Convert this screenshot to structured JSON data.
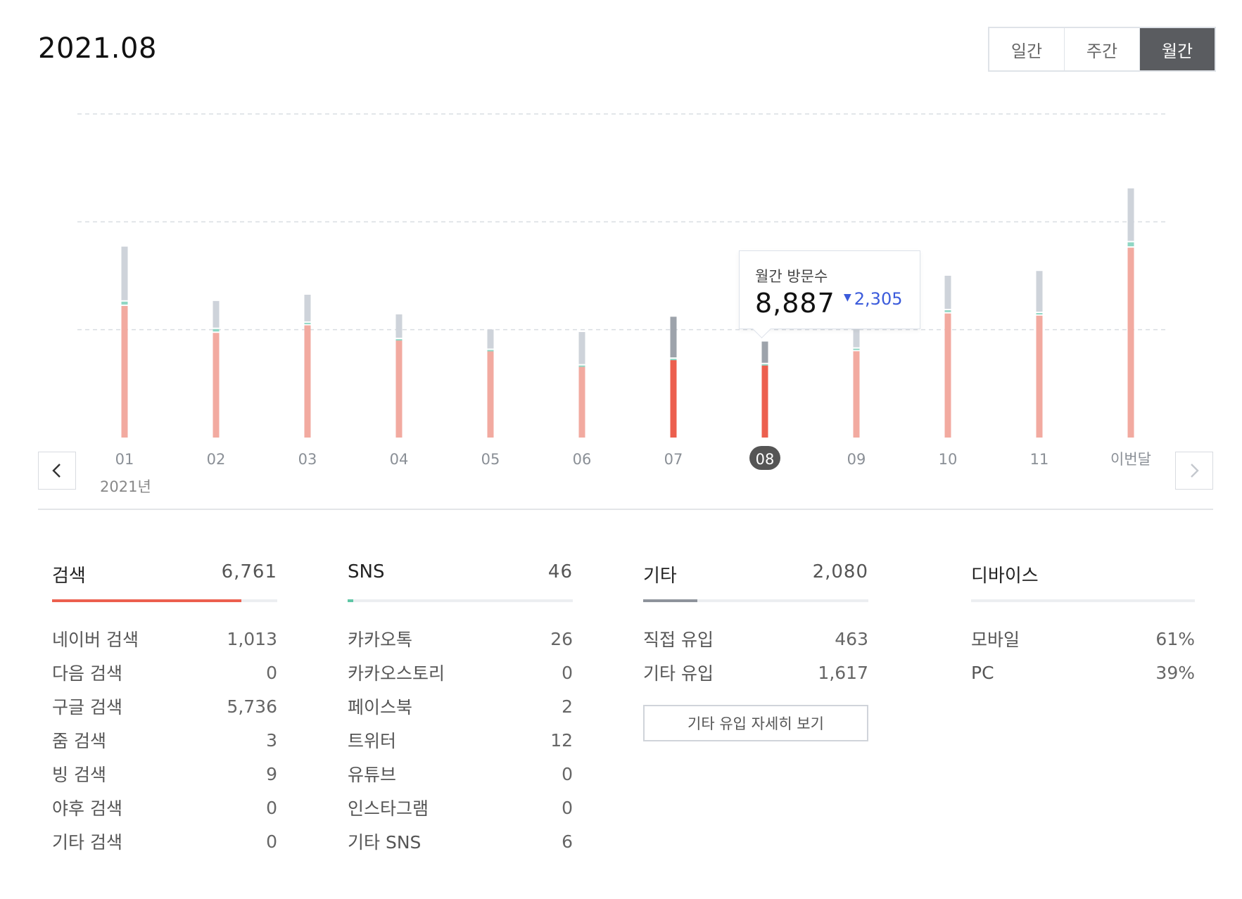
{
  "header": {
    "period": "2021.08"
  },
  "period_toggle": {
    "options": [
      "일간",
      "주간",
      "월간"
    ],
    "active": 2
  },
  "chart_data": {
    "type": "bar",
    "title": "",
    "categories": [
      "01",
      "02",
      "03",
      "04",
      "05",
      "06",
      "07",
      "08",
      "09",
      "10",
      "11",
      "이번달"
    ],
    "year_label": "2021년",
    "selected_index": 7,
    "highlight_index": 6,
    "ylim": [
      0,
      15000
    ],
    "gridlines": [
      5000,
      10000,
      15000
    ],
    "series": [
      {
        "values": [
          6100,
          4850,
          5200,
          4500,
          4000,
          3300,
          3600,
          3350,
          4000,
          5750,
          5650,
          8800
        ]
      },
      {
        "values": [
          200,
          180,
          120,
          60,
          60,
          40,
          50,
          50,
          120,
          150,
          120,
          250
        ]
      },
      {
        "values": [
          2550,
          1300,
          1300,
          1150,
          950,
          1550,
          1950,
          1050,
          1050,
          1600,
          1950,
          2500
        ]
      }
    ],
    "colors": {
      "search": "#f2aaa0",
      "sns": "#8fd6c3",
      "other": "#ced3da",
      "search_highlight": "#ec5f4e",
      "other_highlight": "#9da3ab",
      "grid": "#d9dde2",
      "selected_badge": "#555555"
    }
  },
  "tooltip": {
    "label": "월간 방문수",
    "value": "8,887",
    "delta": "2,305",
    "delta_color": "#3b5bdb"
  },
  "nav": {
    "prev_icon": "chevron-left-icon",
    "next_icon": "chevron-right-icon"
  },
  "stats": {
    "search": {
      "title": "검색",
      "total": "6,761",
      "bar_fraction": 0.84,
      "bar_color": "#ec5f4e",
      "items": [
        {
          "label": "네이버 검색",
          "value": "1,013"
        },
        {
          "label": "다음 검색",
          "value": "0"
        },
        {
          "label": "구글 검색",
          "value": "5,736"
        },
        {
          "label": "줌 검색",
          "value": "3"
        },
        {
          "label": "빙 검색",
          "value": "9"
        },
        {
          "label": "야후 검색",
          "value": "0"
        },
        {
          "label": "기타 검색",
          "value": "0"
        }
      ]
    },
    "sns": {
      "title": "SNS",
      "total": "46",
      "bar_fraction": 0.025,
      "bar_color": "#5fc6a6",
      "items": [
        {
          "label": "카카오톡",
          "value": "26"
        },
        {
          "label": "카카오스토리",
          "value": "0"
        },
        {
          "label": "페이스북",
          "value": "2"
        },
        {
          "label": "트위터",
          "value": "12"
        },
        {
          "label": "유튜브",
          "value": "0"
        },
        {
          "label": "인스타그램",
          "value": "0"
        },
        {
          "label": "기타 SNS",
          "value": "6"
        }
      ]
    },
    "other": {
      "title": "기타",
      "total": "2,080",
      "bar_fraction": 0.24,
      "bar_color": "#8e939b",
      "items": [
        {
          "label": "직접 유입",
          "value": "463"
        },
        {
          "label": "기타 유입",
          "value": "1,617"
        }
      ],
      "detail_button": "기타 유입 자세히 보기"
    },
    "device": {
      "title": "디바이스",
      "items": [
        {
          "label": "모바일",
          "value": "61%"
        },
        {
          "label": "PC",
          "value": "39%"
        }
      ]
    }
  }
}
